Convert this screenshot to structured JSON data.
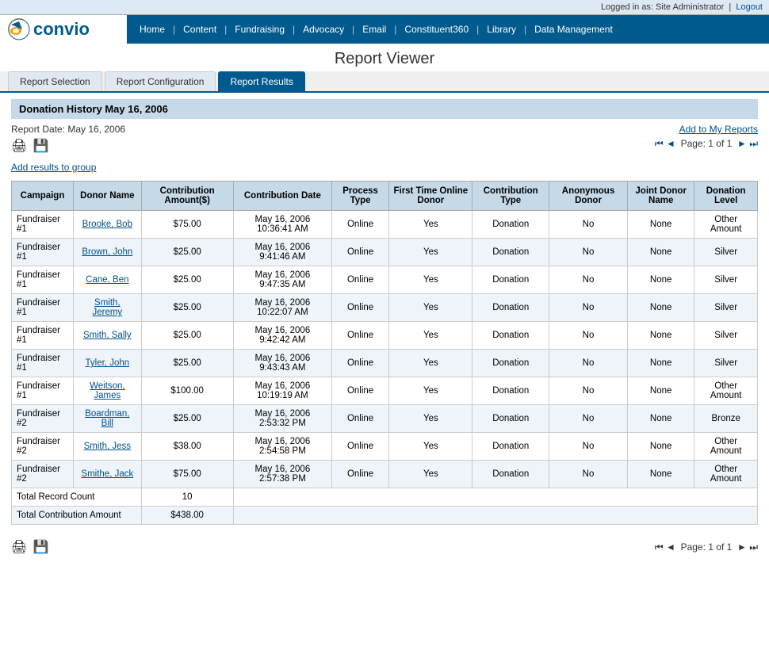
{
  "topbar": {
    "logged_in_text": "Logged in as: Site Administrator",
    "logout_label": "Logout"
  },
  "nav": {
    "logo_text": "convio",
    "links": [
      {
        "label": "Home"
      },
      {
        "label": "Content"
      },
      {
        "label": "Fundraising"
      },
      {
        "label": "Advocacy"
      },
      {
        "label": "Email"
      },
      {
        "label": "Constituent360"
      },
      {
        "label": "Library"
      },
      {
        "label": "Data Management"
      }
    ]
  },
  "page": {
    "title": "Report Viewer"
  },
  "tabs": [
    {
      "label": "Report Selection",
      "active": false
    },
    {
      "label": "Report Configuration",
      "active": false
    },
    {
      "label": "Report Results",
      "active": true
    }
  ],
  "report": {
    "title": "Donation History May 16, 2006",
    "date_label": "Report Date: May 16, 2006",
    "add_to_reports": "Add to My Reports",
    "pagination": "Page: 1 of 1",
    "add_results": "Add results to group",
    "total_record_count_label": "Total Record Count",
    "total_record_count_value": "10",
    "total_contribution_label": "Total Contribution Amount",
    "total_contribution_value": "$438.00"
  },
  "table": {
    "headers": [
      "Campaign",
      "Donor Name",
      "Contribution Amount($)",
      "Contribution Date",
      "Process Type",
      "First Time Online Donor",
      "Contribution Type",
      "Anonymous Donor",
      "Joint Donor Name",
      "Donation Level"
    ],
    "rows": [
      {
        "campaign": "Fundraiser #1",
        "donor_name": "Brooke, Bob",
        "amount": "$75.00",
        "date": "May 16, 2006 10:36:41 AM",
        "process_type": "Online",
        "first_time": "Yes",
        "contribution_type": "Donation",
        "anonymous": "No",
        "joint_donor": "None",
        "donation_level": "Other Amount"
      },
      {
        "campaign": "Fundraiser #1",
        "donor_name": "Brown, John",
        "amount": "$25.00",
        "date": "May 16, 2006 9:41:46 AM",
        "process_type": "Online",
        "first_time": "Yes",
        "contribution_type": "Donation",
        "anonymous": "No",
        "joint_donor": "None",
        "donation_level": "Silver"
      },
      {
        "campaign": "Fundraiser #1",
        "donor_name": "Cane, Ben",
        "amount": "$25.00",
        "date": "May 16, 2006 9:47:35 AM",
        "process_type": "Online",
        "first_time": "Yes",
        "contribution_type": "Donation",
        "anonymous": "No",
        "joint_donor": "None",
        "donation_level": "Silver"
      },
      {
        "campaign": "Fundraiser #1",
        "donor_name": "Smith, Jeremy",
        "amount": "$25.00",
        "date": "May 16, 2006 10:22:07 AM",
        "process_type": "Online",
        "first_time": "Yes",
        "contribution_type": "Donation",
        "anonymous": "No",
        "joint_donor": "None",
        "donation_level": "Silver"
      },
      {
        "campaign": "Fundraiser #1",
        "donor_name": "Smith, Sally",
        "amount": "$25.00",
        "date": "May 16, 2006 9:42:42 AM",
        "process_type": "Online",
        "first_time": "Yes",
        "contribution_type": "Donation",
        "anonymous": "No",
        "joint_donor": "None",
        "donation_level": "Silver"
      },
      {
        "campaign": "Fundraiser #1",
        "donor_name": "Tyler, John",
        "amount": "$25.00",
        "date": "May 16, 2006 9:43:43 AM",
        "process_type": "Online",
        "first_time": "Yes",
        "contribution_type": "Donation",
        "anonymous": "No",
        "joint_donor": "None",
        "donation_level": "Silver"
      },
      {
        "campaign": "Fundraiser #1",
        "donor_name": "Weitson, James",
        "amount": "$100.00",
        "date": "May 16, 2006 10:19:19 AM",
        "process_type": "Online",
        "first_time": "Yes",
        "contribution_type": "Donation",
        "anonymous": "No",
        "joint_donor": "None",
        "donation_level": "Other Amount"
      },
      {
        "campaign": "Fundraiser #2",
        "donor_name": "Boardman, Bill",
        "amount": "$25.00",
        "date": "May 16, 2006 2:53:32 PM",
        "process_type": "Online",
        "first_time": "Yes",
        "contribution_type": "Donation",
        "anonymous": "No",
        "joint_donor": "None",
        "donation_level": "Bronze"
      },
      {
        "campaign": "Fundraiser #2",
        "donor_name": "Smith, Jess",
        "amount": "$38.00",
        "date": "May 16, 2006 2:54:58 PM",
        "process_type": "Online",
        "first_time": "Yes",
        "contribution_type": "Donation",
        "anonymous": "No",
        "joint_donor": "None",
        "donation_level": "Other Amount"
      },
      {
        "campaign": "Fundraiser #2",
        "donor_name": "Smithe, Jack",
        "amount": "$75.00",
        "date": "May 16, 2006 2:57:38 PM",
        "process_type": "Online",
        "first_time": "Yes",
        "contribution_type": "Donation",
        "anonymous": "No",
        "joint_donor": "None",
        "donation_level": "Other Amount"
      }
    ]
  }
}
